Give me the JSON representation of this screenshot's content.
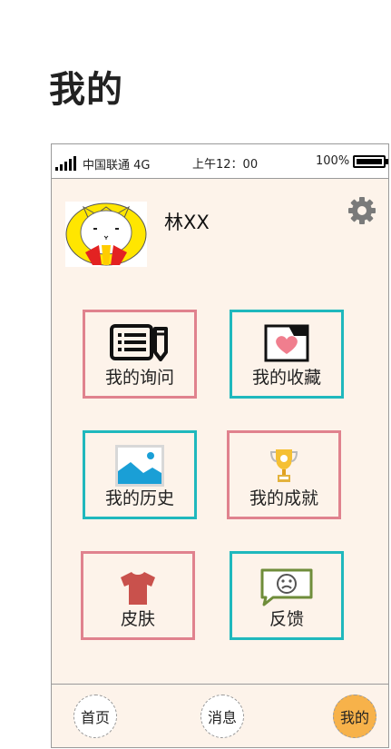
{
  "page": {
    "title": "我的"
  },
  "status": {
    "carrier": "中国联通 4G",
    "time": "上午12：00",
    "battery": "100%"
  },
  "profile": {
    "name": "林XX"
  },
  "tiles": [
    {
      "label": "我的询问"
    },
    {
      "label": "我的收藏"
    },
    {
      "label": "我的历史"
    },
    {
      "label": "我的成就"
    },
    {
      "label": "皮肤"
    },
    {
      "label": "反馈"
    }
  ],
  "tabs": [
    {
      "label": "首页"
    },
    {
      "label": "消息"
    },
    {
      "label": "我的"
    }
  ],
  "colors": {
    "pink": "#e0828e",
    "teal": "#1fb8bd",
    "background": "#fdf3ea",
    "active_tab": "#f7b24a"
  },
  "icons": [
    "signal-icon",
    "battery-icon",
    "gear-icon",
    "list-pencil-icon",
    "folder-heart-icon",
    "picture-icon",
    "trophy-icon",
    "shirt-icon",
    "sad-message-icon"
  ]
}
